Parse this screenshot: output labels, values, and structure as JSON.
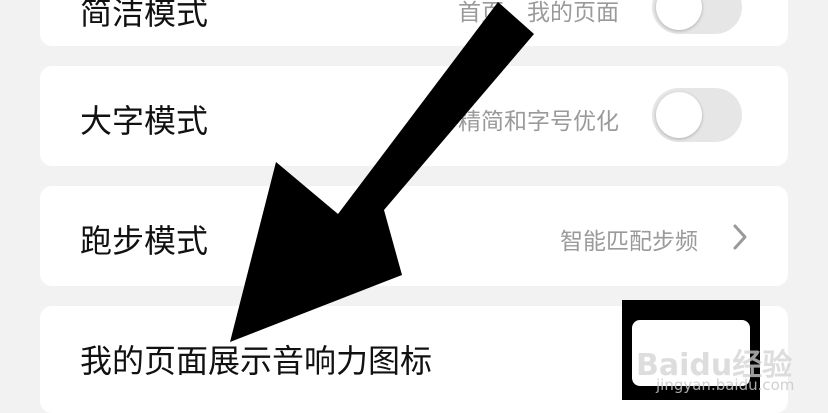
{
  "rows": [
    {
      "title": "简洁模式",
      "desc": "首页、我的页面"
    },
    {
      "title": "大字模式",
      "desc": "精简和字号优化"
    },
    {
      "title": "跑步模式",
      "desc": "智能匹配步频"
    },
    {
      "title": "我的页面展示音响力图标"
    }
  ],
  "watermark": {
    "logo": "Baidu经验",
    "url": "jingyan.baidu.com"
  },
  "icons": {
    "chevron": "chevron-right-icon",
    "annotation": "pointer-arrow-icon"
  },
  "colors": {
    "background": "#f2f2f2",
    "card": "#ffffff",
    "title": "#111111",
    "desc": "#9a9a9a",
    "toggle_off": "#e6e6e6",
    "arrow": "#000000"
  }
}
